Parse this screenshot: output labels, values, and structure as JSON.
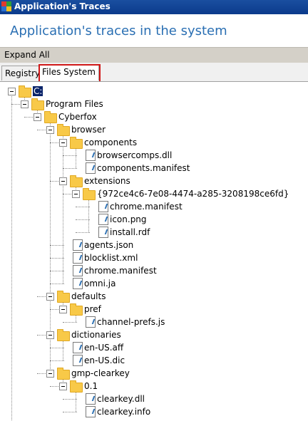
{
  "window": {
    "title": "Application's Traces"
  },
  "heading": "Application's traces in the system",
  "toolbar": {
    "expand_all": "Expand All"
  },
  "tabs": {
    "registry": "Registry",
    "files": "Files System"
  },
  "colors": {
    "accent": "#2a6fb3",
    "highlight": "#d01818",
    "folder": "#f8c948"
  },
  "tree": [
    {
      "label": "C:",
      "depth": 0,
      "type": "folder",
      "expanded": true,
      "selected": true
    },
    {
      "label": "Program Files",
      "depth": 1,
      "type": "folder",
      "expanded": true
    },
    {
      "label": "Cyberfox",
      "depth": 2,
      "type": "folder",
      "expanded": true
    },
    {
      "label": "browser",
      "depth": 3,
      "type": "folder",
      "expanded": true
    },
    {
      "label": "components",
      "depth": 4,
      "type": "folder",
      "expanded": true
    },
    {
      "label": "browsercomps.dll",
      "depth": 5,
      "type": "file"
    },
    {
      "label": "components.manifest",
      "depth": 5,
      "type": "file"
    },
    {
      "label": "extensions",
      "depth": 4,
      "type": "folder",
      "expanded": true
    },
    {
      "label": "{972ce4c6-7e08-4474-a285-3208198ce6fd}",
      "depth": 5,
      "type": "folder",
      "expanded": true
    },
    {
      "label": "chrome.manifest",
      "depth": 6,
      "type": "file"
    },
    {
      "label": "icon.png",
      "depth": 6,
      "type": "file"
    },
    {
      "label": "install.rdf",
      "depth": 6,
      "type": "file"
    },
    {
      "label": "agents.json",
      "depth": 4,
      "type": "file"
    },
    {
      "label": "blocklist.xml",
      "depth": 4,
      "type": "file"
    },
    {
      "label": "chrome.manifest",
      "depth": 4,
      "type": "file"
    },
    {
      "label": "omni.ja",
      "depth": 4,
      "type": "file"
    },
    {
      "label": "defaults",
      "depth": 3,
      "type": "folder",
      "expanded": true
    },
    {
      "label": "pref",
      "depth": 4,
      "type": "folder",
      "expanded": true
    },
    {
      "label": "channel-prefs.js",
      "depth": 5,
      "type": "file"
    },
    {
      "label": "dictionaries",
      "depth": 3,
      "type": "folder",
      "expanded": true
    },
    {
      "label": "en-US.aff",
      "depth": 4,
      "type": "file"
    },
    {
      "label": "en-US.dic",
      "depth": 4,
      "type": "file"
    },
    {
      "label": "gmp-clearkey",
      "depth": 3,
      "type": "folder",
      "expanded": true
    },
    {
      "label": "0.1",
      "depth": 4,
      "type": "folder",
      "expanded": true
    },
    {
      "label": "clearkey.dll",
      "depth": 5,
      "type": "file"
    },
    {
      "label": "clearkey.info",
      "depth": 5,
      "type": "file"
    }
  ]
}
